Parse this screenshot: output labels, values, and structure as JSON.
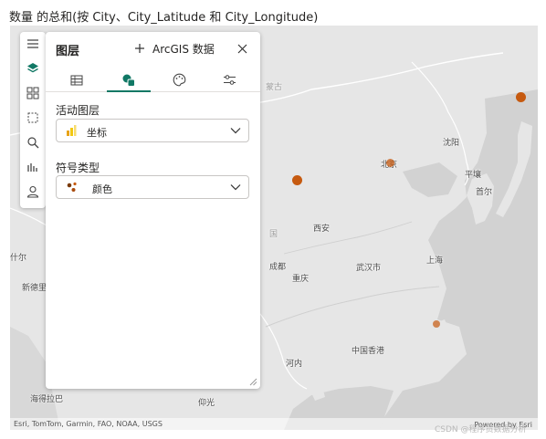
{
  "visual_title": "数量 的总和(按 City、City_Latitude 和 City_Longitude)",
  "layers_panel": {
    "title": "图层",
    "add_data_label": "ArcGIS 数据",
    "active_layer_label": "活动图层",
    "active_layer_value": "坐标",
    "symbol_type_label": "符号类型",
    "symbol_type_value": "颜色"
  },
  "toolbar": {
    "icons": [
      "menu-icon",
      "layers-icon",
      "basemap-icon",
      "select-area-icon",
      "search-icon",
      "analytics-icon",
      "user-icon"
    ]
  },
  "panel_tabs": [
    "table-icon",
    "symbology-icon",
    "palette-icon",
    "settings-sliders-icon"
  ],
  "map": {
    "places": [
      "沈阳",
      "北京",
      "平壤",
      "首尔",
      "西安",
      "成都",
      "重庆",
      "武汉市",
      "上海",
      "中国香港",
      "河内",
      "海得拉巴",
      "仰光",
      "新德里",
      "什尔",
      "蒙古",
      "国"
    ],
    "attribution": "Esri, TomTom, Garmin, FAO, NOAA, USGS",
    "powered_by": "Powered by Esri",
    "bubble_color": "#c65a10"
  },
  "watermark": "CSDN @程序员数据分析"
}
